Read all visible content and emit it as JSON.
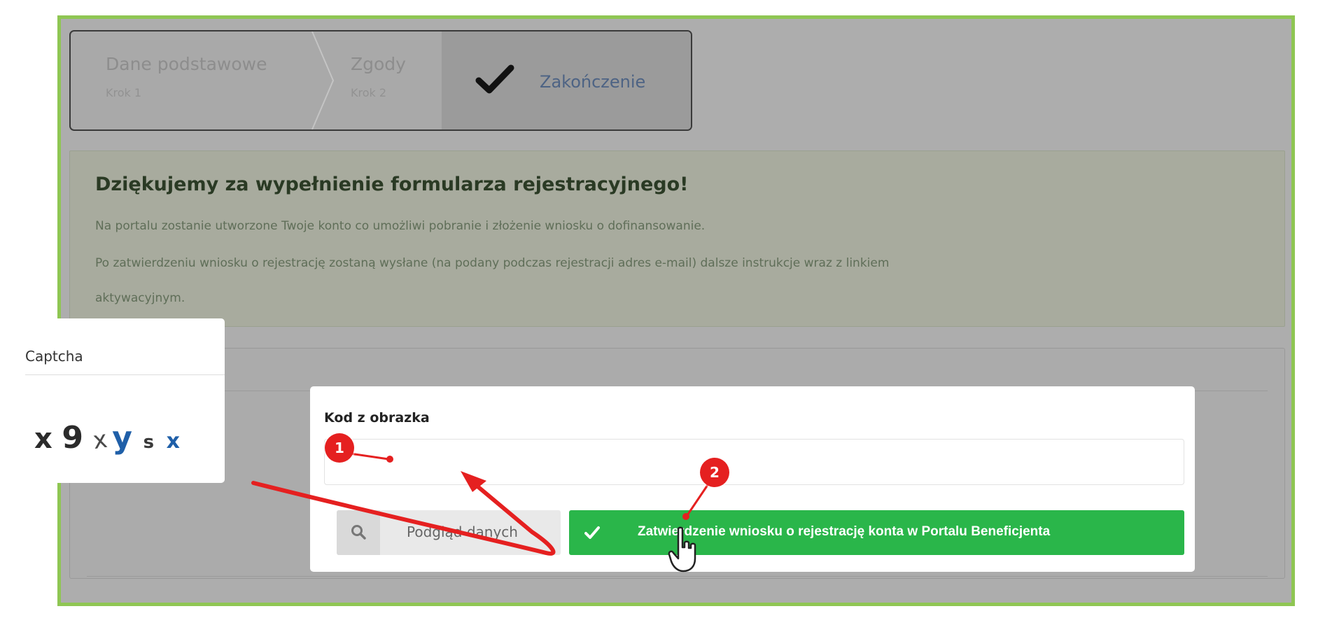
{
  "wizard": {
    "steps": [
      {
        "title": "Dane podstawowe",
        "subtitle": "Krok 1"
      },
      {
        "title": "Zgody",
        "subtitle": "Krok 2"
      },
      {
        "title": "Zakończenie"
      }
    ],
    "active_step_icon": "checkmark-icon"
  },
  "info": {
    "title": "Dziękujemy za wypełnienie formularza rejestracyjnego!",
    "line1": "Na portalu zostanie utworzone Twoje konto co umożliwi pobranie i złożenie wniosku o dofinansowanie.",
    "line2": "Po zatwierdzeniu wniosku o rejestrację zostaną wysłane (na podany podczas rejestracji adres e-mail) dalsze instrukcje wraz z linkiem",
    "line3": "aktywacyjnym."
  },
  "captcha": {
    "label": "Captcha",
    "chars": [
      {
        "c": "x",
        "color": "#2b2b2b"
      },
      {
        "c": "9",
        "color": "#2b2b2b"
      },
      {
        "c": "x",
        "color": "#4a4a4a"
      },
      {
        "c": "y",
        "color": "#1f5fa8"
      },
      {
        "c": "s",
        "color": "#3a3a3a"
      },
      {
        "c": "x",
        "color": "#1f5fa8"
      }
    ]
  },
  "form": {
    "code_label": "Kod z obrazka",
    "code_value": "",
    "preview_label": "Podgląd danych",
    "confirm_label": "Zatwierdzenie wniosku o rejestrację konta w Portalu Beneficjenta"
  },
  "annotations": {
    "marker1": "1",
    "marker2": "2"
  },
  "colors": {
    "frame": "#8fc653",
    "confirm_button": "#2ab64a",
    "annotation": "#e52020",
    "step_active_text": "#4d6384"
  }
}
